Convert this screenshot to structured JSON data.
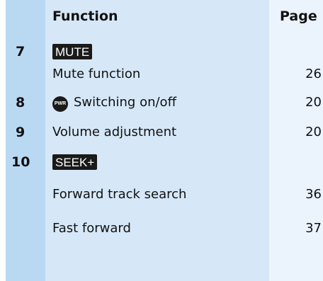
{
  "header": {
    "function_label": "Function",
    "page_label": "Page"
  },
  "rows": [
    {
      "number": "7",
      "key": "MUTE"
    },
    {
      "function": "Mute function",
      "page": "26"
    },
    {
      "number": "8",
      "icon_text": "PWR",
      "function": "Switching on/off",
      "page": "20"
    },
    {
      "number": "9",
      "function": "Volume adjustment",
      "page": "20"
    },
    {
      "number": "10",
      "key": "SEEK+"
    },
    {
      "function": "Forward track search",
      "page": "36"
    },
    {
      "function": "Fast forward",
      "page": "37"
    }
  ],
  "colors": {
    "number_column": "#b9d9f3",
    "function_column": "#d6e8f8",
    "page_column": "#ebf4fc",
    "key_background": "#1a1a1a"
  }
}
